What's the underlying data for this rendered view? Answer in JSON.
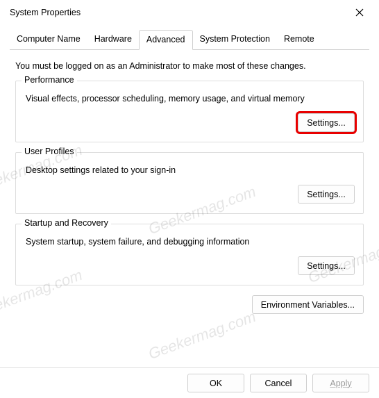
{
  "window": {
    "title": "System Properties"
  },
  "tabs": {
    "t0": "Computer Name",
    "t1": "Hardware",
    "t2": "Advanced",
    "t3": "System Protection",
    "t4": "Remote"
  },
  "intro": "You must be logged on as an Administrator to make most of these changes.",
  "groups": {
    "performance": {
      "title": "Performance",
      "desc": "Visual effects, processor scheduling, memory usage, and virtual memory",
      "button": "Settings..."
    },
    "user_profiles": {
      "title": "User Profiles",
      "desc": "Desktop settings related to your sign-in",
      "button": "Settings..."
    },
    "startup": {
      "title": "Startup and Recovery",
      "desc": "System startup, system failure, and debugging information",
      "button": "Settings..."
    }
  },
  "env_button": "Environment Variables...",
  "buttons": {
    "ok": "OK",
    "cancel": "Cancel",
    "apply": "Apply"
  },
  "watermark": "Geekermag.com"
}
